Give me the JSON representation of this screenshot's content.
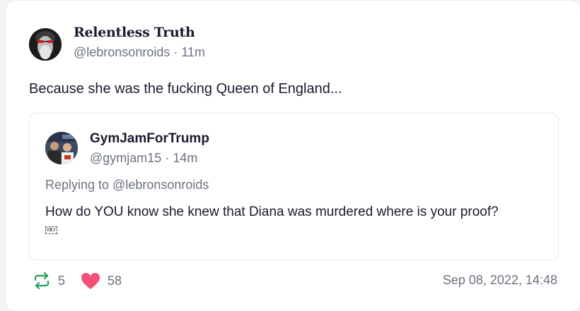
{
  "post": {
    "author": {
      "display_name": "Relentless Truth",
      "handle": "@lebronsonroids",
      "age": "11m"
    },
    "text": "Because she was the fucking Queen of England...",
    "quote": {
      "author": {
        "display_name": "GymJamForTrump",
        "handle": "@gymjam15",
        "age": "14m"
      },
      "replying_to": "Replying to @lebronsonroids",
      "text": "How do YOU know she knew that Diana was murdered where is your proof?",
      "attachment_placeholder": "OBJ"
    },
    "stats": {
      "reposts": "5",
      "likes": "58"
    },
    "timestamp": "Sep 08, 2022, 14:48"
  },
  "icons": {
    "repost": "repost-icon",
    "like": "heart-icon"
  },
  "colors": {
    "repost_green": "#22a05a",
    "like_pink": "#f0507a",
    "muted_text": "#6b7280",
    "primary_text": "#1a1a2e"
  }
}
